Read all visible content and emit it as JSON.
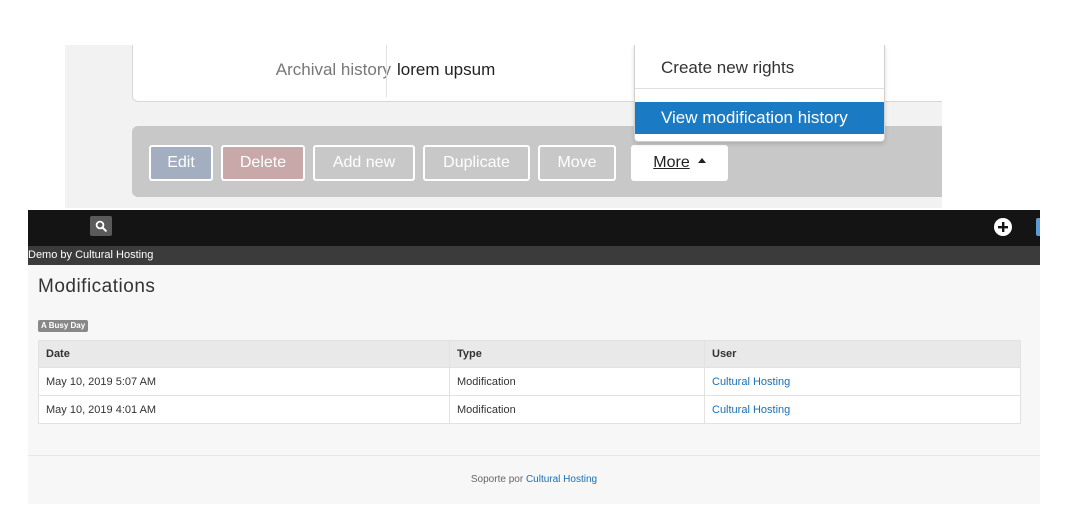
{
  "record": {
    "field_label": "Archival history",
    "field_value": "lorem upsum"
  },
  "actions": {
    "edit": "Edit",
    "delete": "Delete",
    "add_new": "Add new",
    "duplicate": "Duplicate",
    "move": "Move",
    "more": "More"
  },
  "dropdown": {
    "create_rights": "Create new rights",
    "view_history": "View modification history"
  },
  "topbar": {
    "site_name": "Demo by Cultural Hosting",
    "icons": {
      "search": "search-icon",
      "add": "plus-circle-icon"
    }
  },
  "page": {
    "title": "Modifications",
    "badge": "A Busy Day"
  },
  "table": {
    "headers": [
      "Date",
      "Type",
      "User"
    ],
    "rows": [
      {
        "date": "May 10, 2019 5:07 AM",
        "type": "Modification",
        "user": "Cultural Hosting"
      },
      {
        "date": "May 10, 2019 4:01 AM",
        "type": "Modification",
        "user": "Cultural Hosting"
      }
    ]
  },
  "footer": {
    "prefix": "Soporte por",
    "link": "Cultural Hosting"
  },
  "colors": {
    "accent": "#1a7ac3",
    "link": "#1a6fb5",
    "topbar": "#141414"
  }
}
